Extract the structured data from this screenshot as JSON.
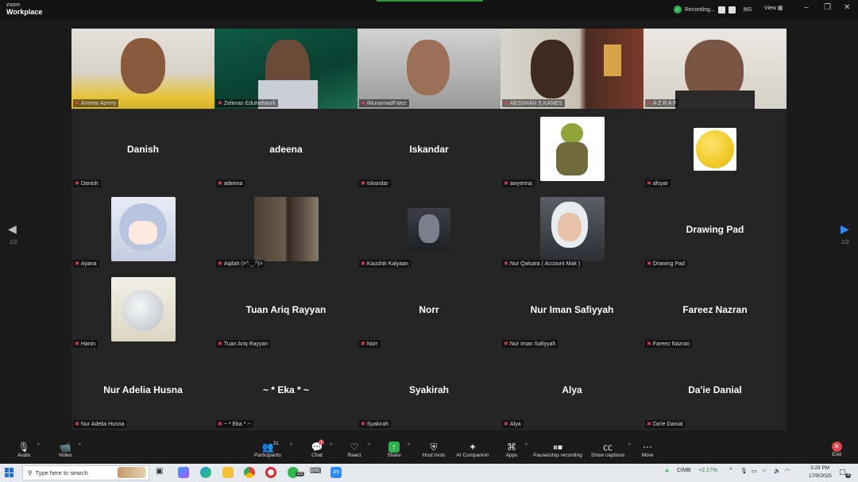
{
  "app": {
    "brand_small": "zoom",
    "brand_name": "Workplace"
  },
  "topbar": {
    "recording_label": "Recording...",
    "user_initials": "MS",
    "view_label": "View"
  },
  "pages": {
    "left": "1/2",
    "right": "1/2"
  },
  "video_tiles": [
    {
      "label": "Ammar Azrery"
    },
    {
      "label": "Zeliman EduNetwork"
    },
    {
      "label": "iMunamadFaiez"
    },
    {
      "label": "AESSHAN S.KANES"
    },
    {
      "label": "A Z R A F"
    }
  ],
  "participants": [
    {
      "name": "Danish",
      "label": "Danish"
    },
    {
      "name": "adeena",
      "label": "adeena"
    },
    {
      "name": "Iskandar",
      "label": "Iskandar"
    },
    {
      "name": "",
      "label": "awyenna"
    },
    {
      "name": "",
      "label": "afsyar"
    },
    {
      "name": "",
      "label": "Ayana"
    },
    {
      "name": "",
      "label": "Aqilah (>^._.^)>"
    },
    {
      "name": "",
      "label": "Kaushik Kalyaan"
    },
    {
      "name": "",
      "label": "Nur Qalsara ( Account Mak )"
    },
    {
      "name": "Drawing Pad",
      "label": "Drawing Pad"
    },
    {
      "name": "",
      "label": "Hanin"
    },
    {
      "name": "Tuan Ariq Rayyan",
      "label": "Tuan Ariq Rayyan"
    },
    {
      "name": "Norr",
      "label": "Norr"
    },
    {
      "name": "Nur Iman Safiyyah",
      "label": "Nur Iman Safiyyah"
    },
    {
      "name": "Fareez Nazran",
      "label": "Fareez Nazran"
    },
    {
      "name": "Nur Adelia Husna",
      "label": "Nur Adelia Husna"
    },
    {
      "name": "~ * Eka * ~",
      "label": "~ * Eka * ~"
    },
    {
      "name": "Syakirah",
      "label": "Syakirah"
    },
    {
      "name": "Alya",
      "label": "Alya"
    },
    {
      "name": "Da'ie Danial",
      "label": "Da'ie Danial"
    }
  ],
  "toolbar": {
    "audio": "Audio",
    "video": "Video",
    "participants": "Participants",
    "participants_count": "31",
    "chat": "Chat",
    "chat_badge": "1",
    "react": "React",
    "share": "Share",
    "host_tools": "Host tools",
    "companion": "AI Companion",
    "apps": "Apps",
    "pause_recording": "Pause/stop recording",
    "captions": "Show captions",
    "more": "More",
    "end": "End"
  },
  "taskbar": {
    "search_placeholder": "Type here to search",
    "stock_name": "CIMB",
    "stock_change": "+2.17%",
    "time": "3:29 PM",
    "date": "17/9/2025",
    "notification_count": "4",
    "whatsapp_badge": "23"
  },
  "colors": {
    "accent_green": "#2bb24c",
    "mic_red": "#e0444a",
    "stage_bg": "#232323"
  }
}
